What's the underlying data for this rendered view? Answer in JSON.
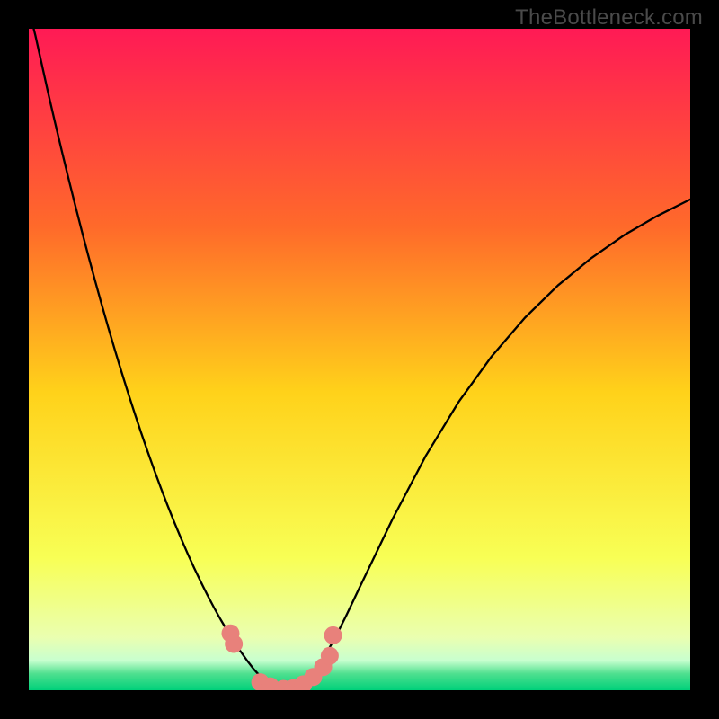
{
  "watermark": {
    "text": "TheBottleneck.com"
  },
  "chart_data": {
    "type": "line",
    "title": "",
    "xlabel": "",
    "ylabel": "",
    "xlim": [
      0,
      100
    ],
    "ylim": [
      0,
      100
    ],
    "grid": false,
    "legend": false,
    "background_gradient_stops": [
      {
        "pos": 0.0,
        "color": "#ff1a55"
      },
      {
        "pos": 0.3,
        "color": "#ff6a2a"
      },
      {
        "pos": 0.55,
        "color": "#ffd21a"
      },
      {
        "pos": 0.8,
        "color": "#f8ff55"
      },
      {
        "pos": 0.92,
        "color": "#eaffb0"
      },
      {
        "pos": 0.955,
        "color": "#c8ffcf"
      },
      {
        "pos": 0.975,
        "color": "#4fe08f"
      },
      {
        "pos": 1.0,
        "color": "#00d07a"
      }
    ],
    "series": [
      {
        "name": "bottleneck-curve",
        "stroke": "#000000",
        "stroke_width": 2.3,
        "x": [
          0,
          1,
          2,
          3,
          4,
          5,
          6,
          7,
          8,
          9,
          10,
          11,
          12,
          13,
          14,
          15,
          16,
          17,
          18,
          19,
          20,
          21,
          22,
          23,
          24,
          25,
          26,
          27,
          28,
          29,
          30,
          31,
          32,
          33,
          34,
          35,
          36,
          37,
          38,
          39,
          40,
          41,
          42,
          43,
          44,
          45,
          46,
          47,
          48,
          49,
          50,
          55,
          60,
          65,
          70,
          75,
          80,
          85,
          90,
          95,
          100
        ],
        "y": [
          103,
          99,
          94.5,
          90,
          85.7,
          81.5,
          77.4,
          73.4,
          69.5,
          65.7,
          62,
          58.4,
          54.9,
          51.5,
          48.2,
          45,
          41.9,
          38.9,
          36,
          33.2,
          30.5,
          27.9,
          25.4,
          23,
          20.7,
          18.5,
          16.4,
          14.4,
          12.5,
          10.7,
          9,
          7.4,
          5.9,
          4.5,
          3.2,
          2.1,
          1.2,
          0.5,
          0.1,
          0,
          0.2,
          0.7,
          1.5,
          2.6,
          4,
          5.6,
          7.4,
          9.3,
          11.3,
          13.4,
          15.5,
          25.9,
          35.4,
          43.6,
          50.5,
          56.3,
          61.2,
          65.3,
          68.8,
          71.7,
          74.2
        ]
      }
    ],
    "markers": {
      "name": "highlight-points",
      "fill": "#e8817b",
      "radius": 10,
      "points": [
        {
          "x": 30.5,
          "y": 8.6
        },
        {
          "x": 31.0,
          "y": 7.0
        },
        {
          "x": 35.0,
          "y": 1.2
        },
        {
          "x": 36.5,
          "y": 0.6
        },
        {
          "x": 38.5,
          "y": 0.2
        },
        {
          "x": 40.0,
          "y": 0.3
        },
        {
          "x": 41.5,
          "y": 0.9
        },
        {
          "x": 43.0,
          "y": 2.0
        },
        {
          "x": 44.5,
          "y": 3.5
        },
        {
          "x": 45.5,
          "y": 5.2
        },
        {
          "x": 46.0,
          "y": 8.3
        }
      ]
    }
  }
}
